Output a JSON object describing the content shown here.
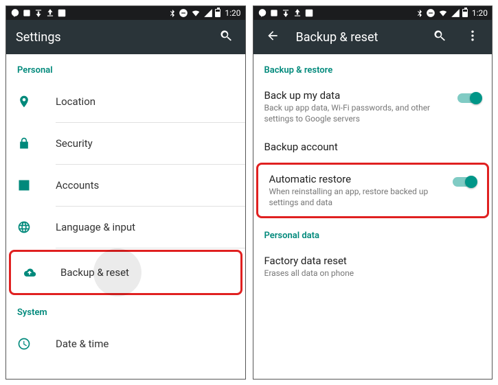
{
  "statusbar": {
    "time": "1:20"
  },
  "left": {
    "title": "Settings",
    "section": "Personal",
    "items": [
      {
        "label": "Location"
      },
      {
        "label": "Security"
      },
      {
        "label": "Accounts"
      },
      {
        "label": "Language & input"
      },
      {
        "label": "Backup & reset"
      }
    ],
    "section2": "System",
    "items2": [
      {
        "label": "Date & time"
      }
    ]
  },
  "right": {
    "title": "Backup & reset",
    "section_backup": "Backup & restore",
    "backup_my_data": {
      "title": "Back up my data",
      "summary": "Back up app data, Wi-Fi passwords, and other settings to Google servers"
    },
    "backup_account": {
      "title": "Backup account"
    },
    "auto_restore": {
      "title": "Automatic restore",
      "summary": "When reinstalling an app, restore backed up settings and data"
    },
    "section_personal": "Personal data",
    "factory_reset": {
      "title": "Factory data reset",
      "summary": "Erases all data on phone"
    }
  }
}
